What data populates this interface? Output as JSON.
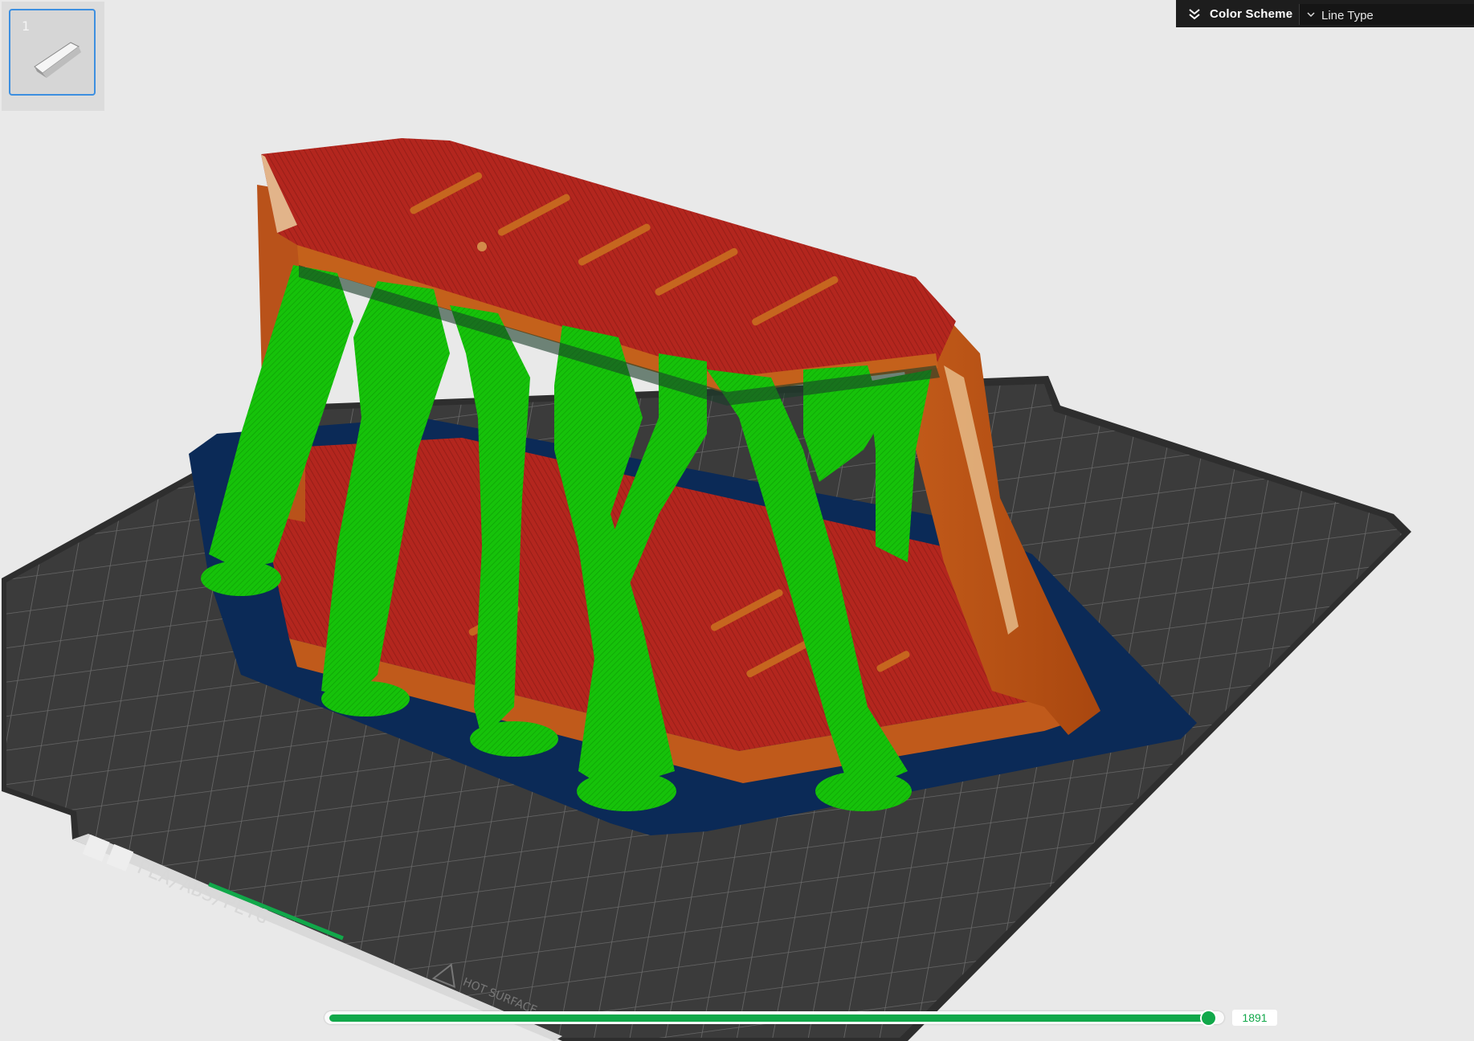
{
  "plate_list": {
    "items": [
      {
        "number": "1"
      }
    ]
  },
  "color_scheme": {
    "label": "Color Scheme",
    "selected": "Line Type"
  },
  "bed": {
    "label": "PLA/ABS/PETG",
    "warning": "HOT SURFACE"
  },
  "layer_slider": {
    "value": "1891",
    "fraction": 1.0
  },
  "colors": {
    "background": "#e9e9e9",
    "bed": "#3a3a3a",
    "skirt_brim": "#0d2a55",
    "top_surface": "#b3261e",
    "outer_wall": "#c45a18",
    "support": "#16c20a",
    "accent": "#11a84a"
  }
}
